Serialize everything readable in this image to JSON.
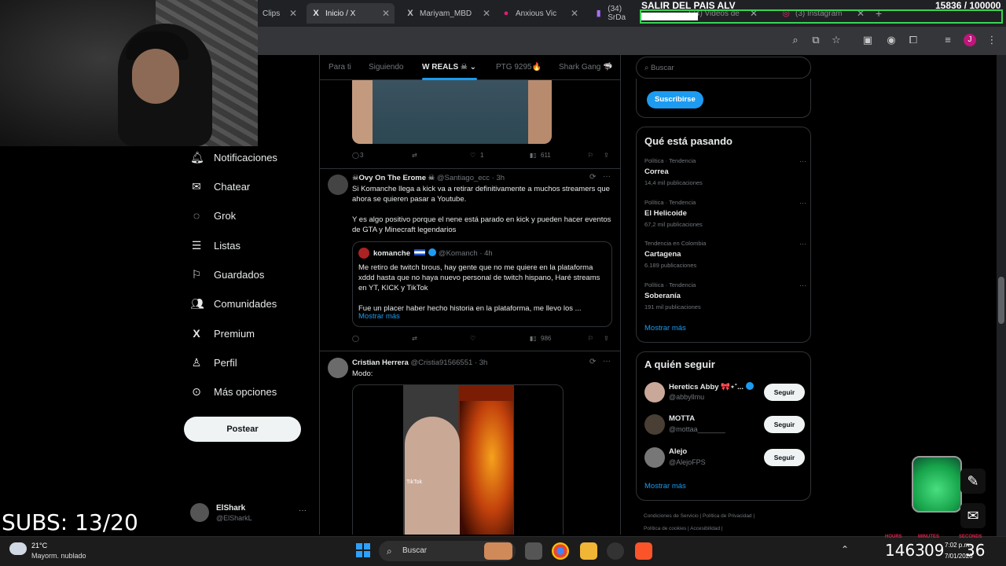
{
  "browser": {
    "tabs": [
      {
        "label": "Clips",
        "icon": "clips-icon"
      },
      {
        "label": "Inicio / X",
        "icon": "x-logo-icon"
      },
      {
        "label": "Mariyam_MBD",
        "icon": "x-logo-icon"
      },
      {
        "label": "Anxious Vic",
        "icon": "kick-icon"
      },
      {
        "label": "(34) SrDa",
        "icon": "twitch-icon"
      },
      {
        "label": "(34) Videos de",
        "icon": "video-icon"
      },
      {
        "label": "(3) Instagram",
        "icon": "instagram-icon"
      }
    ],
    "profile_initial": "J"
  },
  "overlay": {
    "goal_title": "SALIR DEL PAIS ALV",
    "goal_count": "15836 / 100000",
    "goal_progress": 0.158,
    "subs": "SUBS: 13/20"
  },
  "nav": {
    "items": [
      {
        "label": "Notificaciones",
        "icon": "bell-icon"
      },
      {
        "label": "Chatear",
        "icon": "mail-icon"
      },
      {
        "label": "Grok",
        "icon": "grok-icon"
      },
      {
        "label": "Listas",
        "icon": "list-icon"
      },
      {
        "label": "Guardados",
        "icon": "bookmark-icon"
      },
      {
        "label": "Comunidades",
        "icon": "people-icon"
      },
      {
        "label": "Premium",
        "icon": "x-logo-icon"
      },
      {
        "label": "Perfil",
        "icon": "person-icon"
      },
      {
        "label": "Más opciones",
        "icon": "more-circle-icon"
      }
    ],
    "post_button": "Postear",
    "account": {
      "name": "ElShark",
      "handle": "@ElSharkL",
      "more": "···"
    }
  },
  "feed": {
    "tabs": [
      "Para ti",
      "Siguiendo",
      "W REALS ☠ ⌄",
      "PTG 9295🔥",
      "Shark Gang 🦈"
    ],
    "first_post_actions": {
      "replies": "3",
      "reposts": "",
      "likes": "1",
      "views": "611"
    },
    "posts": [
      {
        "name": "☠Ovy On The Erome ☠",
        "handle": "@Santiago_ecc",
        "time": "· 3h",
        "text": "Si Komanche llega a kick va a retirar definitivamente a muchos streamers que ahora se quieren pasar a Youtube.\n\nY es algo positivo porque el nene está parado en kick y pueden hacer eventos de GTA y Minecraft legendarios",
        "quote": {
          "name": "komanche",
          "handle": "@Komanch",
          "time": "· 4h",
          "text": "Me retiro de twitch brous, hay gente que no me quiere en la plataforma xddd hasta que no haya nuevo personal de twitch hispano, Haré streams en YT, KICK y TikTok\n\nFue un placer haber hecho historia en la plataforma, me llevo los ...",
          "show_more": "Mostrar más"
        },
        "actions": {
          "replies": "",
          "reposts": "",
          "likes": "",
          "views": "986"
        }
      },
      {
        "name": "Cristian Herrera",
        "handle": "@Cristia91566551",
        "time": "· 3h",
        "text": "Modo:",
        "media_label": "TikTok"
      }
    ]
  },
  "sidebar": {
    "search_placeholder": "Buscar",
    "subscribe_button": "Suscribirse",
    "trends_title": "Qué está pasando",
    "trends": [
      {
        "category": "Política · Tendencia",
        "title": "Correa",
        "count": "14,4 mil publicaciones"
      },
      {
        "category": "Política · Tendencia",
        "title": "El Helicoide",
        "count": "67,2 mil publicaciones"
      },
      {
        "category": "Tendencia en Colombia",
        "title": "Cartagena",
        "count": "6.189 publicaciones"
      },
      {
        "category": "Política · Tendencia",
        "title": "Soberanía",
        "count": "191 mil publicaciones"
      }
    ],
    "trends_more": "Mostrar más",
    "who_title": "A quién seguir",
    "who": [
      {
        "name": "Heretics Abby 🎀⋆˚...",
        "handle": "@abbyllmu",
        "button": "Seguir"
      },
      {
        "name": "MOTTA",
        "handle": "@mottaa_______",
        "button": "Seguir"
      },
      {
        "name": "Alejo",
        "handle": "@AlejoFPS",
        "button": "Seguir"
      }
    ],
    "who_more": "Mostrar más",
    "footer": [
      "Condiciones de Servicio",
      "Política de Privacidad",
      "Política de cookies",
      "Accesibilidad"
    ]
  },
  "taskbar": {
    "temperature": "21°C",
    "weather": "Mayorm. nublado",
    "search": "Buscar",
    "clock_h": "14",
    "clock_m": "63",
    "clock_mm": "09",
    "clock_s": "36",
    "time_small": "7:02 p.m.",
    "date_small": "7/01/2026",
    "label_hours": "HOURS",
    "label_minutes": "MINUTES",
    "label_seconds": "SECONDS"
  }
}
